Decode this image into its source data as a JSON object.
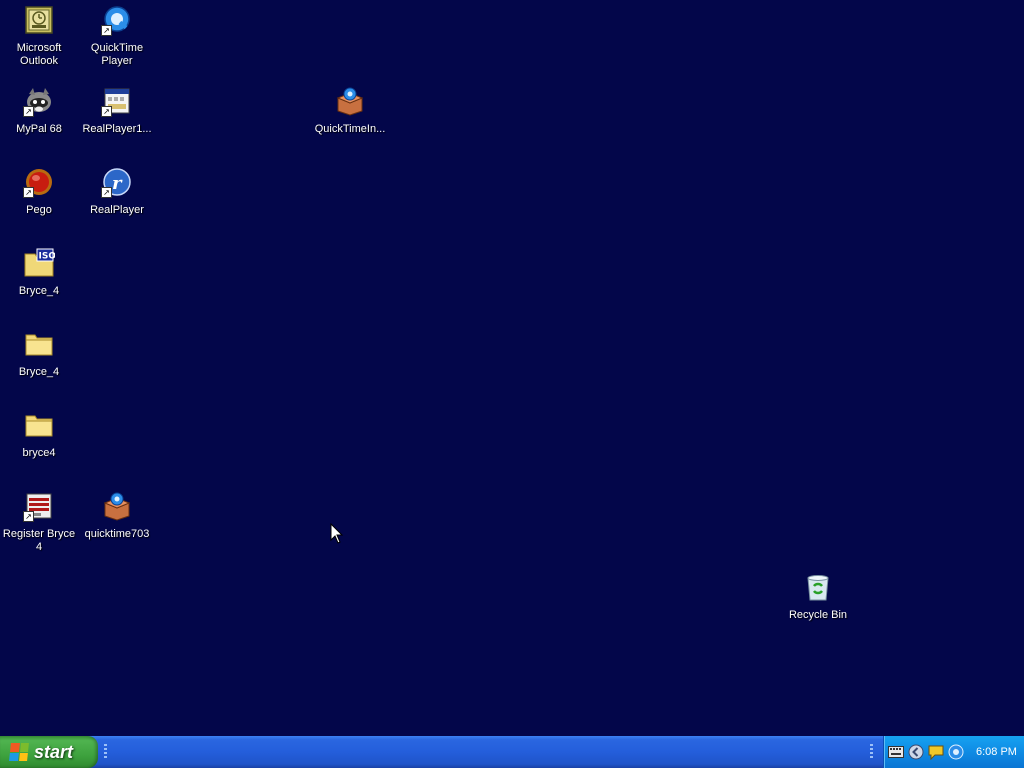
{
  "desktop": {
    "background_color": "#03064a",
    "icons": [
      {
        "label": "Microsoft Outlook",
        "icon": "outlook-icon"
      },
      {
        "label": "QuickTime Player",
        "icon": "quicktime-icon"
      },
      {
        "label": "MyPal 68",
        "icon": "mypal-raccoon-icon"
      },
      {
        "label": "RealPlayer1...",
        "icon": "installer-window-icon"
      },
      {
        "label": "QuickTimeIn...",
        "icon": "installer-box-icon"
      },
      {
        "label": "Pego",
        "icon": "red-orb-icon"
      },
      {
        "label": "RealPlayer",
        "icon": "realplayer-icon"
      },
      {
        "label": "Bryce_4",
        "icon": "iso-file-icon"
      },
      {
        "label": "Bryce_4",
        "icon": "folder-icon"
      },
      {
        "label": "bryce4",
        "icon": "folder-icon"
      },
      {
        "label": "Register Bryce 4",
        "icon": "register-app-icon"
      },
      {
        "label": "quicktime703",
        "icon": "installer-box-icon"
      },
      {
        "label": "Recycle Bin",
        "icon": "recycle-bin-icon"
      }
    ]
  },
  "taskbar": {
    "start_label": "start",
    "tray_icons": [
      "keyboard-icon",
      "back-arrow-icon",
      "chat-bubble-icon",
      "quicktime-tray-icon"
    ],
    "clock": "6:08 PM"
  }
}
